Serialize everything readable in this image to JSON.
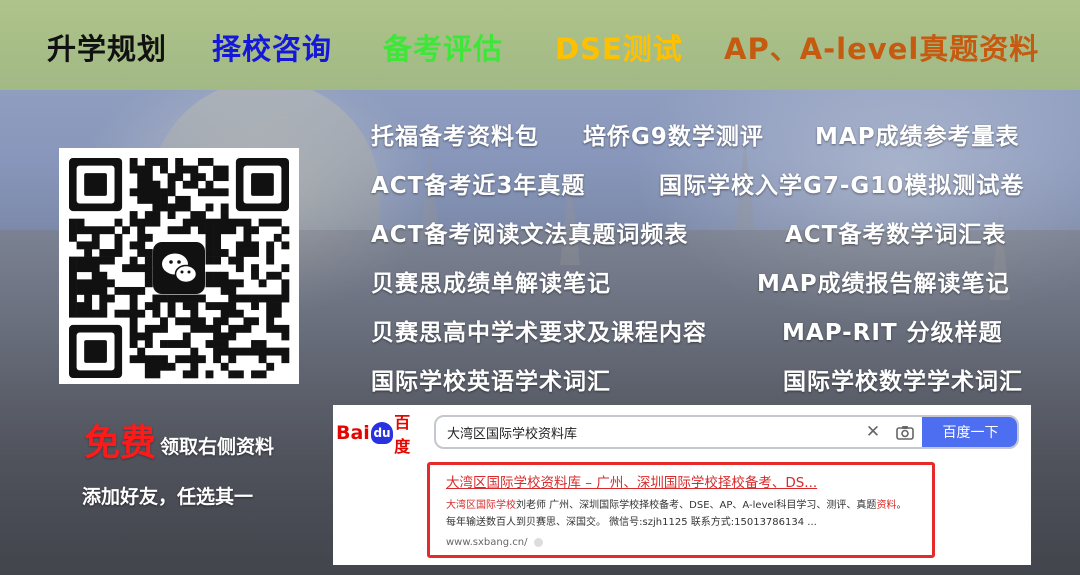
{
  "colors": {
    "topbar_bg": "#a9c085",
    "nav_black": "#111111",
    "nav_blue": "#1518d8",
    "nav_green": "#3ee63a",
    "nav_yellow": "#ffc000",
    "nav_orange": "#c55a11",
    "free_red": "#ff1a1a",
    "baidu_blue": "#4e6ef2",
    "result_red": "#d82a2a"
  },
  "nav": [
    {
      "label": "升学规划"
    },
    {
      "label": "择校咨询"
    },
    {
      "label": "备考评估"
    },
    {
      "label": "DSE测试"
    },
    {
      "label": "AP、A-level真题资料"
    }
  ],
  "resources": [
    {
      "label": "托福备考资料包"
    },
    {
      "label": "培侨G9数学测评"
    },
    {
      "label": "MAP成绩参考量表"
    },
    {
      "label": "ACT备考近3年真题"
    },
    {
      "label": "国际学校入学G7-G10模拟测试卷"
    },
    {
      "label": "ACT备考阅读文法真题词频表"
    },
    {
      "label": "ACT备考数学词汇表"
    },
    {
      "label": "贝赛思成绩单解读笔记"
    },
    {
      "label": "MAP成绩报告解读笔记"
    },
    {
      "label": "贝赛思高中学术要求及课程内容"
    },
    {
      "label": "MAP-RIT 分级样题"
    },
    {
      "label": "国际学校英语学术词汇"
    },
    {
      "label": "国际学校数学学术词汇"
    }
  ],
  "qr": {
    "icon": "wechat-icon"
  },
  "promo": {
    "free": "免费",
    "claim": "领取右侧资料",
    "add_friend": "添加好友，任选其一"
  },
  "baidu": {
    "logo_bai": "Bai",
    "logo_paw": "du",
    "logo_du": "百度",
    "search_value": "大湾区国际学校资料库",
    "search_button": "百度一下",
    "close_icon": "close-icon",
    "camera_icon": "camera-icon",
    "result": {
      "title": "大湾区国际学校资料库 – 广州、深圳国际学校择校备考、DS...",
      "desc_red1": "大湾区国际学校",
      "desc_1": "刘老师 广州、深圳国际学校择校备考、DSE、AP、A-level科目学习、测评、真题",
      "desc_red2": "资料",
      "desc_2": "。每年输送数百人到贝赛思、深国交。 微信号:szjh1125 联系方式:15013786134 ...",
      "url": "www.sxbang.cn/"
    }
  }
}
